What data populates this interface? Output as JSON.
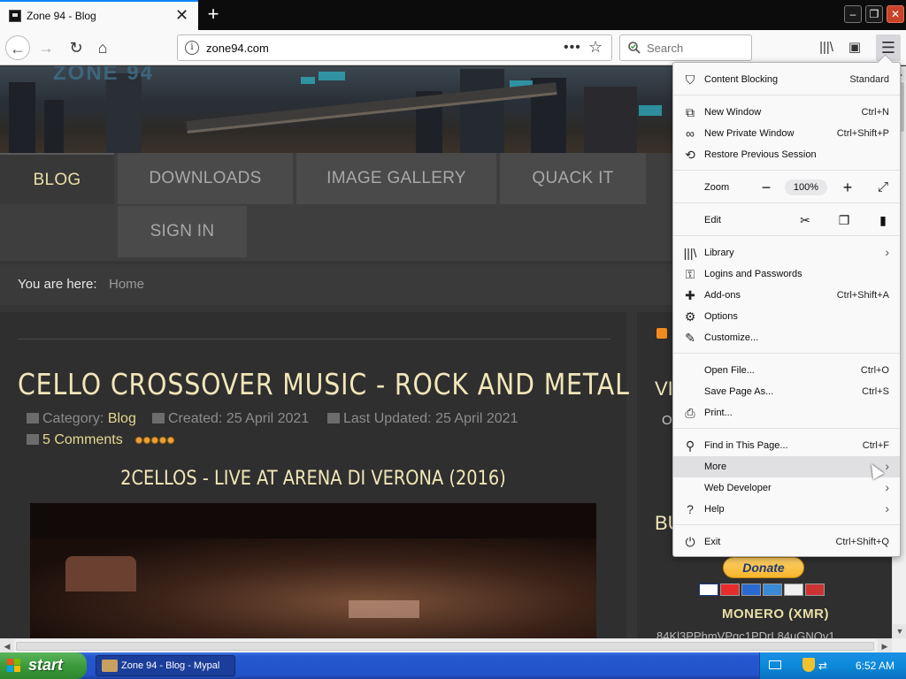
{
  "browser": {
    "tab": {
      "title": "Zone 94 - Blog"
    },
    "newtab_label": "+",
    "window_buttons": {
      "minimize": "–",
      "maximize": "❐",
      "close": "✕"
    },
    "url": "zone94.com",
    "search_placeholder": "Search"
  },
  "site": {
    "logo": "ZONE 94",
    "nav": [
      {
        "label": "BLOG",
        "active": true
      },
      {
        "label": "DOWNLOADS",
        "active": false
      },
      {
        "label": "IMAGE GALLERY",
        "active": false
      },
      {
        "label": "QUACK IT",
        "active": false
      },
      {
        "label": "SIGN IN",
        "active": false
      }
    ],
    "breadcrumb": {
      "prefix": "You are here:",
      "current": "Home"
    }
  },
  "article": {
    "title": "CELLO CROSSOVER MUSIC - ROCK AND METAL",
    "category_label": "Category:",
    "category": "Blog",
    "created": "Created: 25 April 2021",
    "updated": "Last Updated: 25 April 2021",
    "comments": "5 Comments",
    "rating_stars": 5,
    "video_title": "2CELLOS - LIVE AT ARENA DI VERONA (2016)"
  },
  "sidebar": {
    "heading1": "VI",
    "text1": "O",
    "heading2": "BU",
    "donate_label": "Donate",
    "monero_label": "MONERO (XMR)",
    "xmr_address": "84Kl3PPhmVPgc1PDrL84uGNQv1"
  },
  "menu": {
    "content_blocking": {
      "label": "Content Blocking",
      "value": "Standard"
    },
    "new_window": {
      "label": "New Window",
      "shortcut": "Ctrl+N"
    },
    "new_private": {
      "label": "New Private Window",
      "shortcut": "Ctrl+Shift+P"
    },
    "restore_session": {
      "label": "Restore Previous Session"
    },
    "zoom": {
      "label": "Zoom",
      "value": "100%",
      "minus": "−",
      "plus": "+"
    },
    "edit": {
      "label": "Edit"
    },
    "library": {
      "label": "Library"
    },
    "logins": {
      "label": "Logins and Passwords"
    },
    "addons": {
      "label": "Add-ons",
      "shortcut": "Ctrl+Shift+A"
    },
    "options": {
      "label": "Options"
    },
    "customize": {
      "label": "Customize..."
    },
    "open_file": {
      "label": "Open File...",
      "shortcut": "Ctrl+O"
    },
    "save_page": {
      "label": "Save Page As...",
      "shortcut": "Ctrl+S"
    },
    "print": {
      "label": "Print..."
    },
    "find": {
      "label": "Find in This Page...",
      "shortcut": "Ctrl+F"
    },
    "more": {
      "label": "More"
    },
    "web_developer": {
      "label": "Web Developer"
    },
    "help": {
      "label": "Help"
    },
    "exit": {
      "label": "Exit",
      "shortcut": "Ctrl+Shift+Q"
    }
  },
  "taskbar": {
    "start_label": "start",
    "window_button": "Zone 94 - Blog - Mypal",
    "clock": "6:52 AM"
  },
  "colors": {
    "accent_gold": "#e9dfa6",
    "title_cream": "#f2e7b8",
    "firefox_blue": "#0a84ff",
    "xp_blue": "#2352c9",
    "xp_green": "#3c9a3c"
  }
}
